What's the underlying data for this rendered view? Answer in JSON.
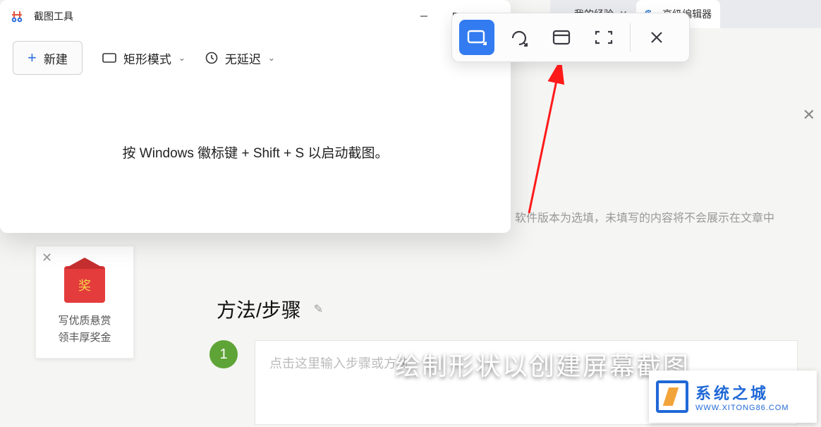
{
  "snip": {
    "title": "截图工具",
    "new_label": "新建",
    "mode_label": "矩形模式",
    "delay_label": "无延迟",
    "hint": "按 Windows 徽标键 + Shift + S 以启动截图。"
  },
  "tabs": {
    "t1_label": "我的经验",
    "t2_label": "高级编辑器"
  },
  "page": {
    "note": "软件版本为选填，未填写的内容将不会展示在文章中",
    "section_title": "方法/步骤",
    "step_num": "1",
    "step_placeholder": "点击这里输入步骤或方法"
  },
  "promo": {
    "badge": "奖",
    "line1": "写优质悬赏",
    "line2": "领丰厚奖金"
  },
  "overlay": "绘制形状以创建屏幕截图",
  "watermark": {
    "cn": "系统之城",
    "en": "WWW.XITONG86.COM"
  }
}
